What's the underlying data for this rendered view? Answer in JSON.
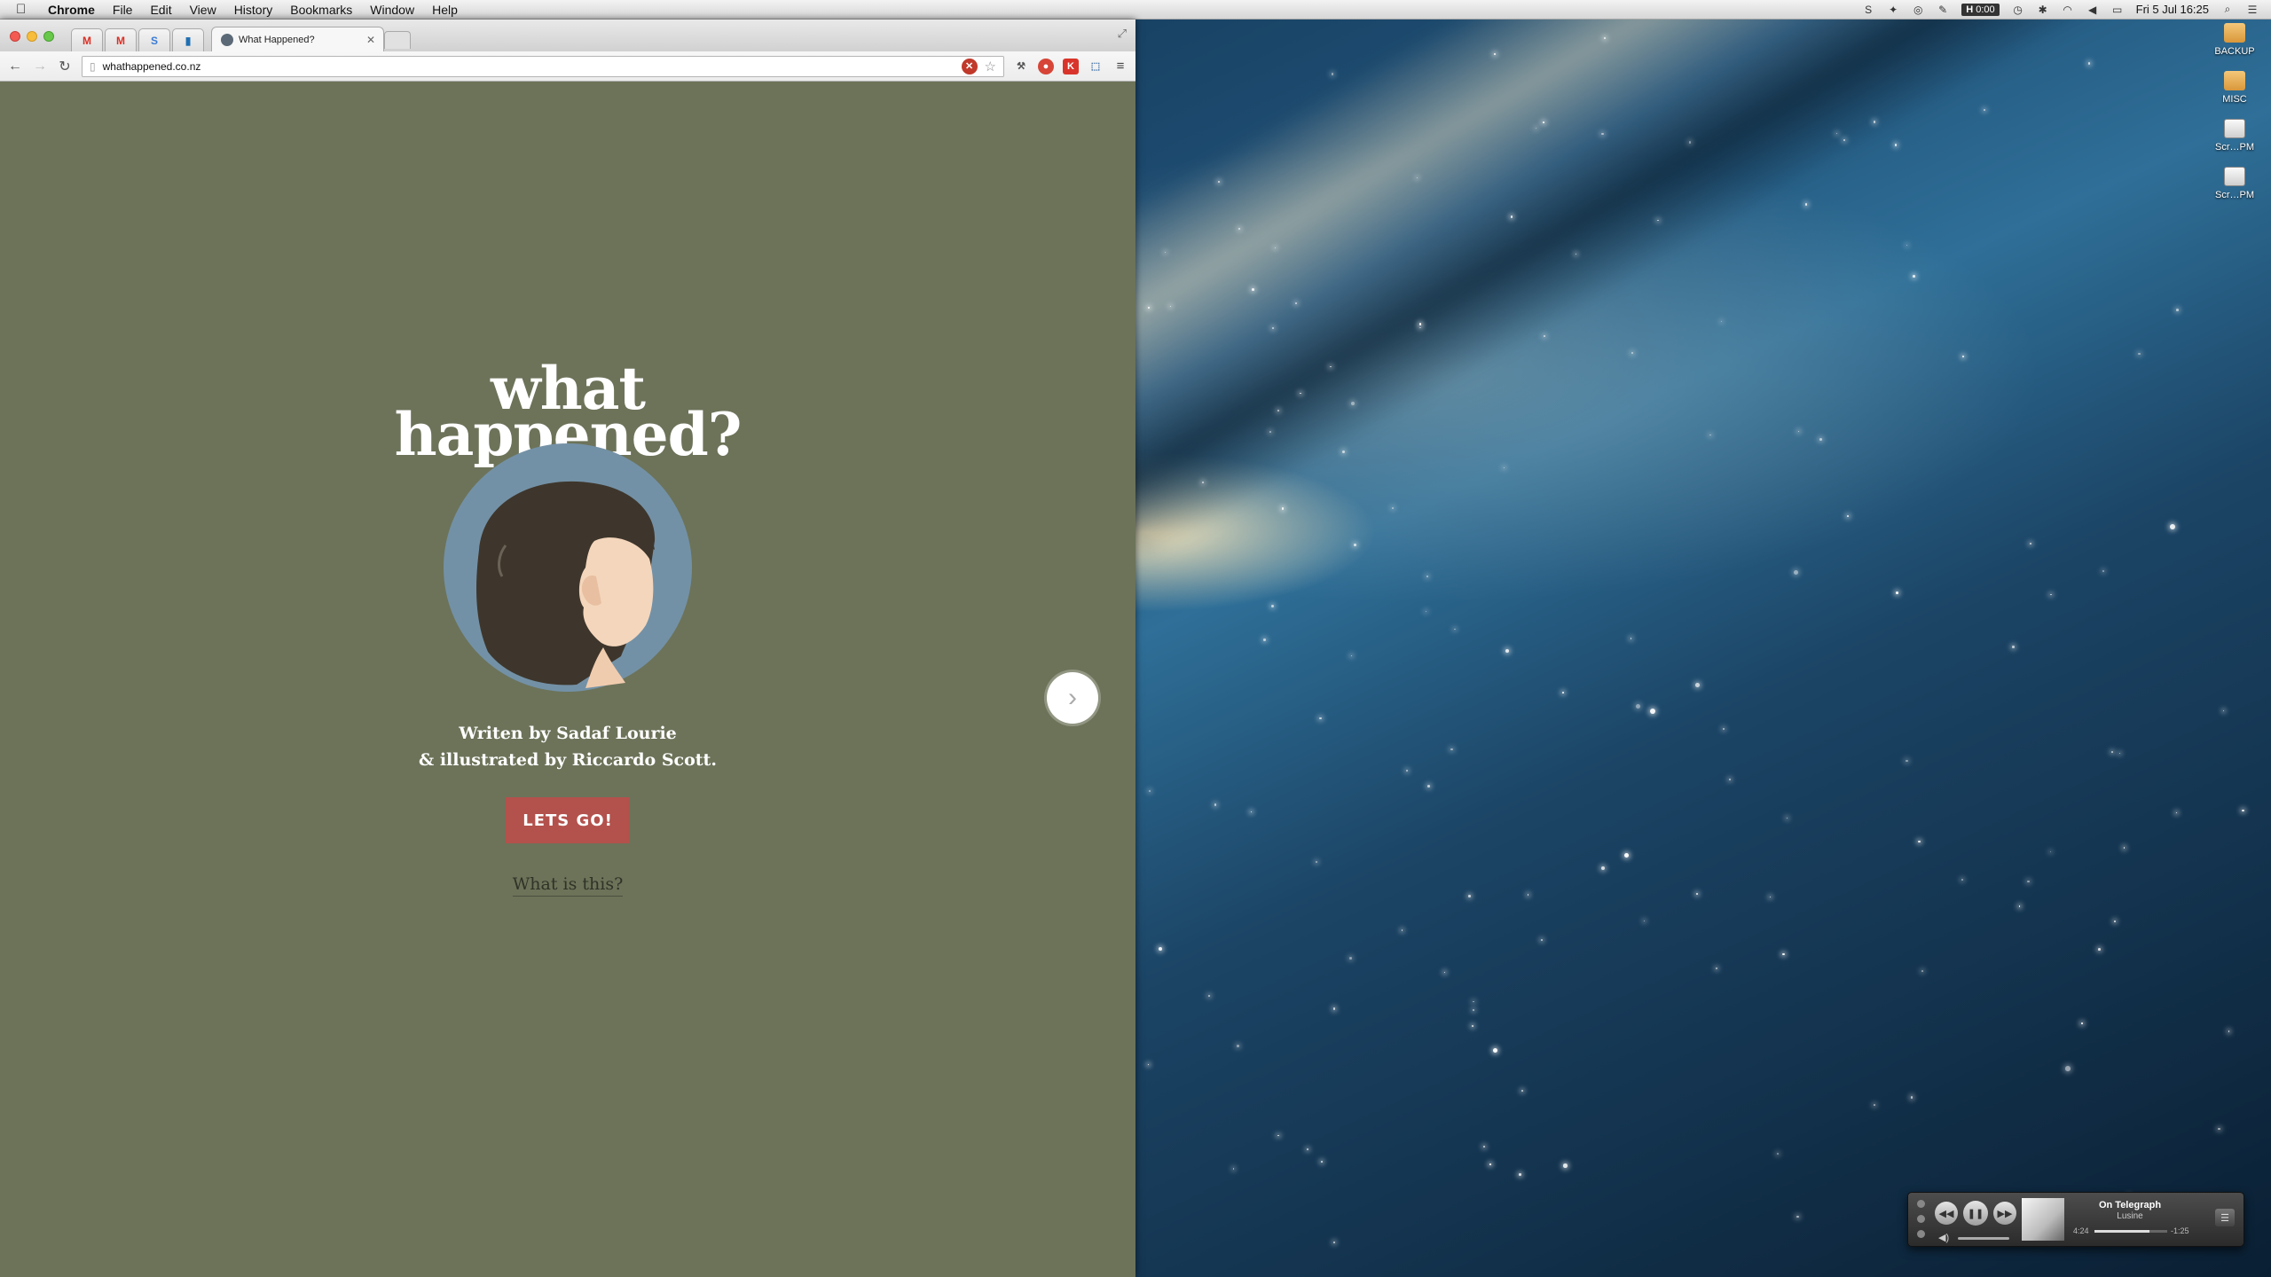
{
  "menubar": {
    "app_name": "Chrome",
    "items": [
      "File",
      "Edit",
      "View",
      "History",
      "Bookmarks",
      "Window",
      "Help"
    ],
    "timer": "0:00",
    "timer_prefix": "H",
    "clock": "Fri 5 Jul  16:25"
  },
  "desktop_icons": [
    {
      "label": "BACKUP",
      "kind": "folder"
    },
    {
      "label": "MISC",
      "kind": "folder"
    },
    {
      "label": "Scr…PM",
      "kind": "doc"
    },
    {
      "label": "Scr…PM",
      "kind": "doc"
    }
  ],
  "browser": {
    "pinned_tabs": [
      {
        "icon": "gmail-icon",
        "glyph": "M",
        "color": "#d93025"
      },
      {
        "icon": "gmail-icon",
        "glyph": "M",
        "color": "#d93025"
      },
      {
        "icon": "app-s-icon",
        "glyph": "S",
        "color": "#3a7bd5"
      },
      {
        "icon": "trello-icon",
        "glyph": "▮",
        "color": "#1f6fb2"
      }
    ],
    "active_tab_title": "What Happened?",
    "url": "whathappened.co.nz"
  },
  "page": {
    "title_line1": "what",
    "title_line2": "happened?",
    "credit_line1": "Writen by Sadaf Lourie",
    "credit_line2": "& illustrated by Riccardo Scott.",
    "cta_label": "LETS GO!",
    "secondary_link": "What is this?",
    "colors": {
      "background": "#6c7359",
      "button": "#b3514c"
    }
  },
  "mini_player": {
    "track": "On Telegraph",
    "artist": "Lusine",
    "elapsed": "4:24",
    "remaining": "-1:25",
    "progress": 0.76
  }
}
